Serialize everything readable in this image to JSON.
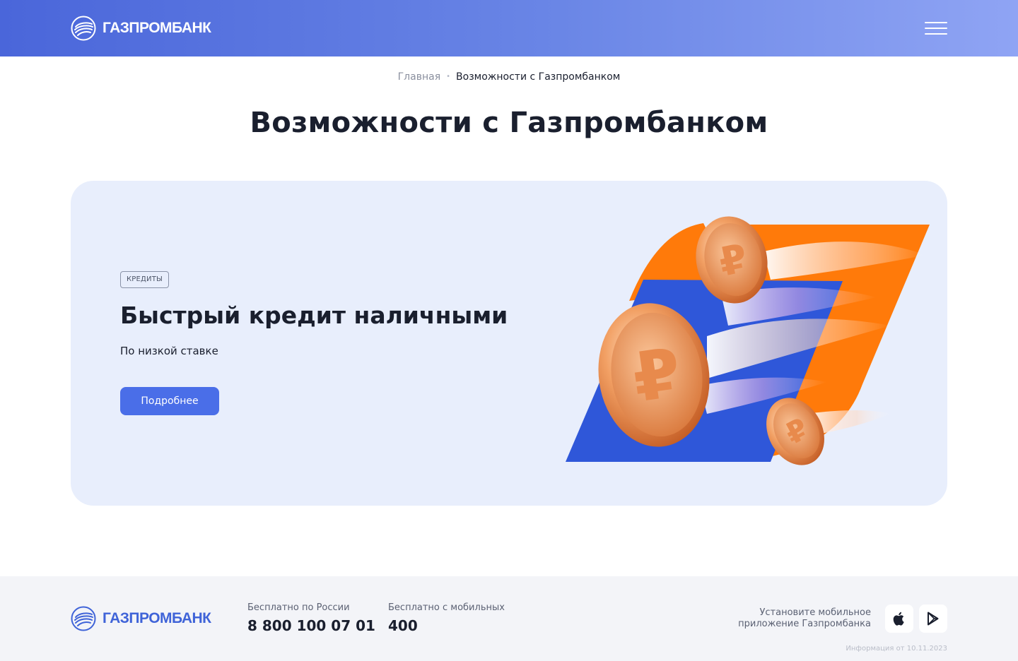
{
  "header": {
    "logo_text": "ГАЗПРОМБАНК",
    "menu_icon": "burger-menu-icon"
  },
  "breadcrumb": {
    "home": "Главная",
    "separator": "•",
    "current": "Возможности с Газпромбанком"
  },
  "page_title": "Возможности с Газпромбанком",
  "promo": {
    "tag": "КРЕДИТЫ",
    "title": "Быстрый кредит наличными",
    "subtitle": "По низкой ставке",
    "button_label": "Подробнее",
    "illustration": "ruble-coins-illustration"
  },
  "footer": {
    "logo_text": "ГАЗПРОМБАНК",
    "phones": [
      {
        "label": "Бесплатно по России",
        "number": "8 800 100 07 01"
      },
      {
        "label": "Бесплатно с мобильных",
        "number": "400"
      }
    ],
    "app_text": "Установите мобильное приложение Газпромбанка",
    "stores": [
      "apple-icon",
      "google-play-icon"
    ],
    "info_date": "Информация от 10.11.2023"
  },
  "colors": {
    "header_start": "#4a66da",
    "header_end": "#8fa4f4",
    "accent": "#4a6ee8",
    "card_bg": "#e8eefc",
    "orange": "#ff7a0a",
    "blue": "#2f57d9"
  }
}
